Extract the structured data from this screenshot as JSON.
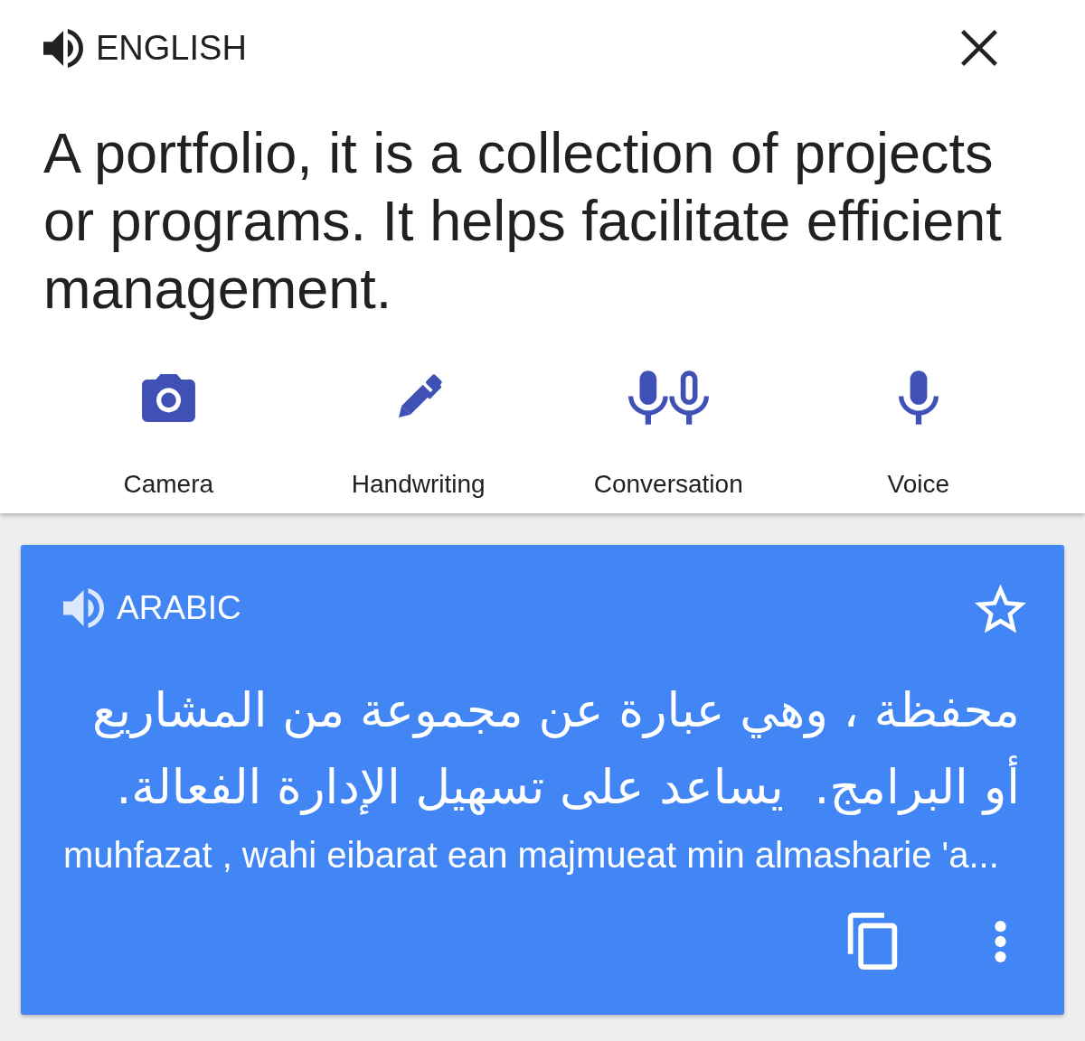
{
  "source": {
    "language": "ENGLISH",
    "text": "A portfolio, it is a collection of projects or programs. It helps facilitate efficient management."
  },
  "input_modes": [
    {
      "kind": "camera",
      "label": "Camera"
    },
    {
      "kind": "handwriting",
      "label": "Handwriting"
    },
    {
      "kind": "conversation",
      "label": "Conversation"
    },
    {
      "kind": "voice",
      "label": "Voice"
    }
  ],
  "translation": {
    "language": "ARABIC",
    "starred": false,
    "text": "محفظة ، وهي عبارة عن مجموعة من المشاريع\nأو البرامج.  يساعد على تسهيل الإدارة الفعالة.",
    "romanization": "muhfazat , wahi eibarat ean majmueat min almasharie 'a..."
  }
}
